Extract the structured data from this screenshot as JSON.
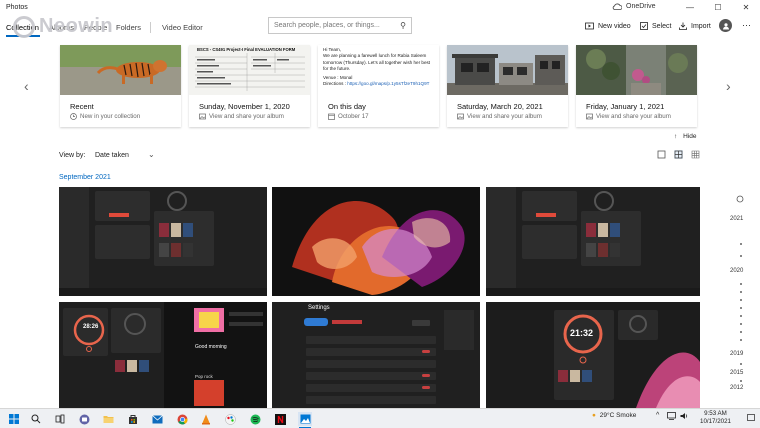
{
  "app": {
    "title": "Photos",
    "onedrive_label": "OneDrive"
  },
  "window_controls": {
    "minimize": "—",
    "maximize": "☐",
    "close": "✕"
  },
  "nav": {
    "tabs": [
      {
        "label": "Collection"
      },
      {
        "label": "Albums"
      },
      {
        "label": "People"
      },
      {
        "label": "Folders"
      }
    ],
    "video_editor": "Video Editor"
  },
  "search": {
    "placeholder": "Search people, places, or things..."
  },
  "actions": {
    "new_video": "New video",
    "select": "Select",
    "import": "Import"
  },
  "watermark": {
    "text": "Neowin"
  },
  "memories": [
    {
      "title": "Recent",
      "subtitle": "New in your collection",
      "icon": "clock-icon"
    },
    {
      "title": "Sunday, November 1, 2020",
      "subtitle": "View and share your album",
      "icon": "album-icon"
    },
    {
      "title": "On this day",
      "subtitle": "October 17",
      "icon": "calendar-icon"
    },
    {
      "title": "Saturday, March 20, 2021",
      "subtitle": "View and share your album",
      "icon": "album-icon"
    },
    {
      "title": "Friday, January 1, 2021",
      "subtitle": "View and share your album",
      "icon": "album-icon"
    }
  ],
  "doc_thumb": {
    "heading": "BSCS - CS491 Project-I Final EVALUATION FORM"
  },
  "message_thumb": {
    "greeting": "Hi Team,",
    "line1": "We are planning a farewell lunch for Rabia Saleem",
    "line2": "tomorrow (Thursday). Let's all together wish her best",
    "line3": "for the future.",
    "venue": "Venue : Monal",
    "directions_label": "Directions : ",
    "directions_link": "https://goo.gl/maps/p.1y5sTf2eT9h1Q9T"
  },
  "hide_label": "Hide",
  "view_by": {
    "label": "View by:",
    "value": "Date taken"
  },
  "month_label": "September 2021",
  "photo_texts": {
    "clock1": "21:32",
    "clock2": "28:26",
    "settings_title": "Settings",
    "good_morning": "Good morning",
    "pop_rock": "Pop rock"
  },
  "timeline": [
    "2021",
    "2020",
    "2019",
    "2015",
    "2012"
  ],
  "taskbar": {
    "weather": "29°C  Smoke",
    "time": "9:53 AM",
    "date": "10/17/2021"
  }
}
